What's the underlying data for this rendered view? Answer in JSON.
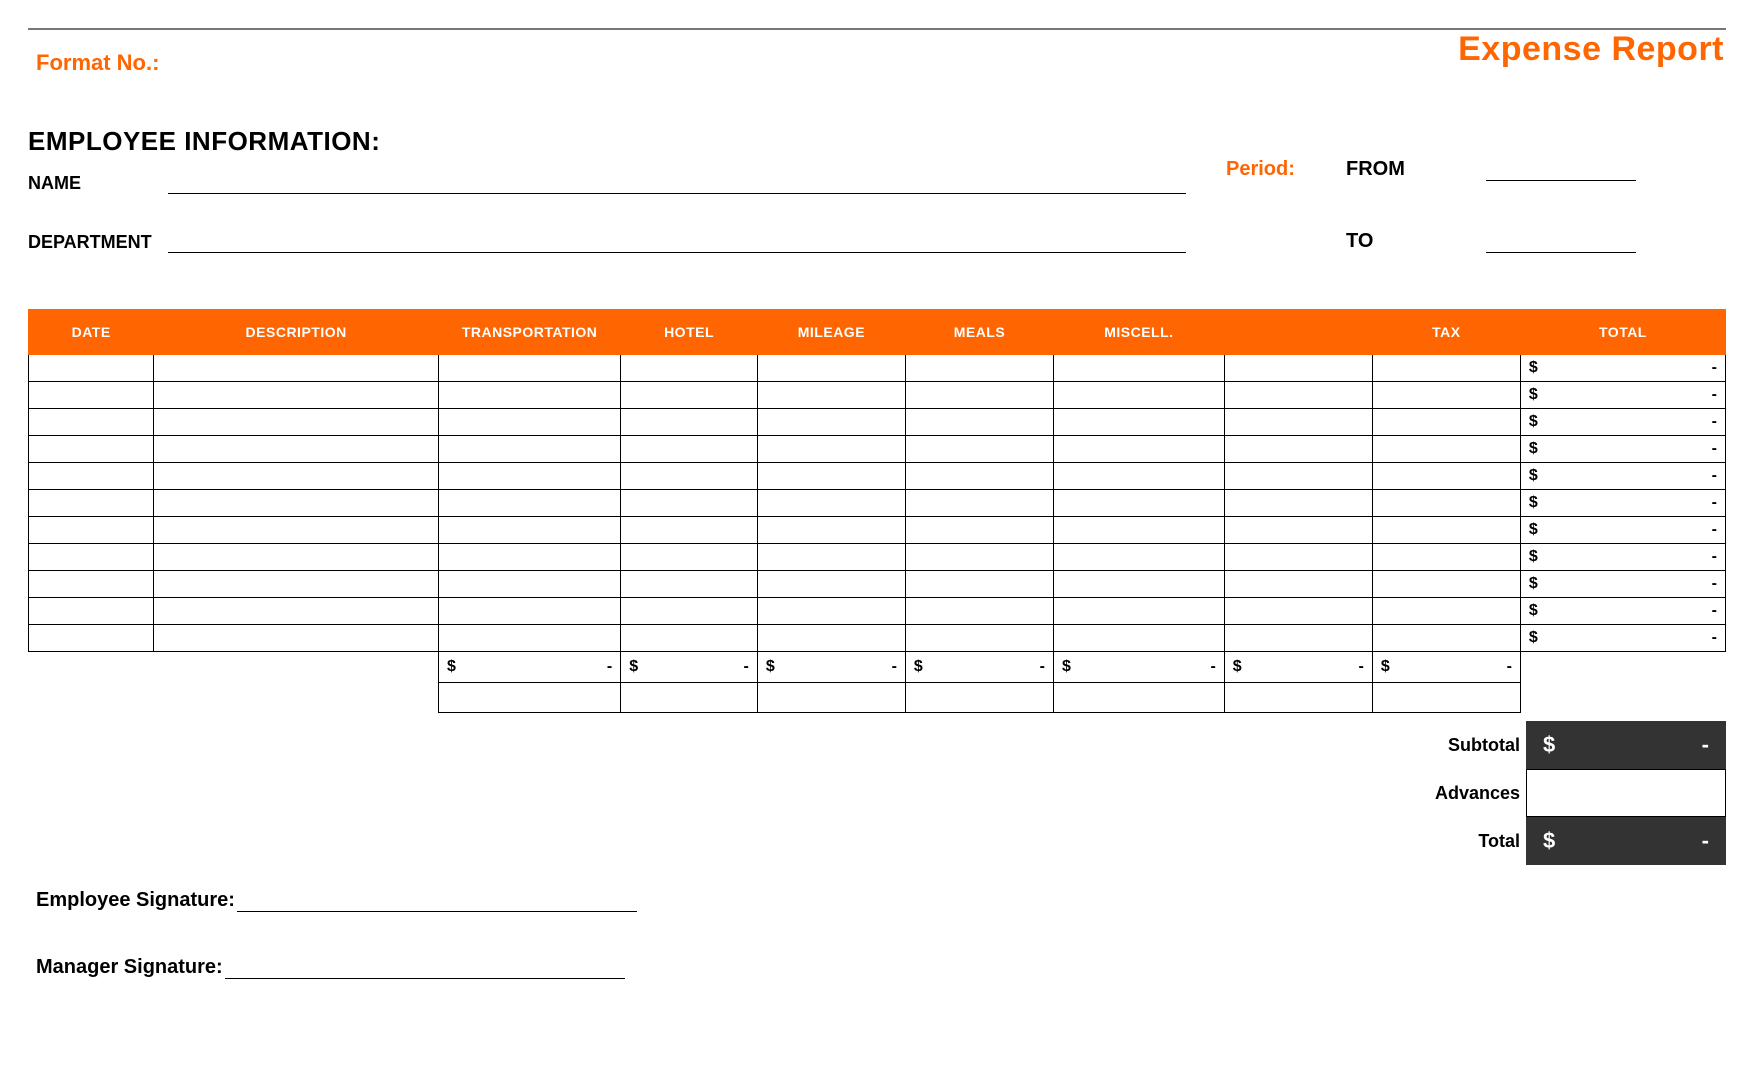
{
  "title": "Expense Report",
  "format_no_label": "Format No.:",
  "employee_info": {
    "heading": "EMPLOYEE INFORMATION:",
    "name_label": "NAME",
    "name_value": "",
    "department_label": "DEPARTMENT",
    "department_value": ""
  },
  "period": {
    "label": "Period:",
    "from_label": "FROM",
    "from_value": "",
    "to_label": "TO",
    "to_value": ""
  },
  "table": {
    "headers": [
      "DATE",
      "DESCRIPTION",
      "TRANSPORTATION",
      "HOTEL",
      "MILEAGE",
      "MEALS",
      "MISCELL.",
      "",
      "TAX",
      "TOTAL"
    ],
    "rows": [
      {
        "date": "",
        "description": "",
        "transportation": "",
        "hotel": "",
        "mileage": "",
        "meals": "",
        "miscell": "",
        "blank": "",
        "tax": "",
        "total_sym": "$",
        "total_val": "-"
      },
      {
        "date": "",
        "description": "",
        "transportation": "",
        "hotel": "",
        "mileage": "",
        "meals": "",
        "miscell": "",
        "blank": "",
        "tax": "",
        "total_sym": "$",
        "total_val": "-"
      },
      {
        "date": "",
        "description": "",
        "transportation": "",
        "hotel": "",
        "mileage": "",
        "meals": "",
        "miscell": "",
        "blank": "",
        "tax": "",
        "total_sym": "$",
        "total_val": "-"
      },
      {
        "date": "",
        "description": "",
        "transportation": "",
        "hotel": "",
        "mileage": "",
        "meals": "",
        "miscell": "",
        "blank": "",
        "tax": "",
        "total_sym": "$",
        "total_val": "-"
      },
      {
        "date": "",
        "description": "",
        "transportation": "",
        "hotel": "",
        "mileage": "",
        "meals": "",
        "miscell": "",
        "blank": "",
        "tax": "",
        "total_sym": "$",
        "total_val": "-"
      },
      {
        "date": "",
        "description": "",
        "transportation": "",
        "hotel": "",
        "mileage": "",
        "meals": "",
        "miscell": "",
        "blank": "",
        "tax": "",
        "total_sym": "$",
        "total_val": "-"
      },
      {
        "date": "",
        "description": "",
        "transportation": "",
        "hotel": "",
        "mileage": "",
        "meals": "",
        "miscell": "",
        "blank": "",
        "tax": "",
        "total_sym": "$",
        "total_val": "-"
      },
      {
        "date": "",
        "description": "",
        "transportation": "",
        "hotel": "",
        "mileage": "",
        "meals": "",
        "miscell": "",
        "blank": "",
        "tax": "",
        "total_sym": "$",
        "total_val": "-"
      },
      {
        "date": "",
        "description": "",
        "transportation": "",
        "hotel": "",
        "mileage": "",
        "meals": "",
        "miscell": "",
        "blank": "",
        "tax": "",
        "total_sym": "$",
        "total_val": "-"
      },
      {
        "date": "",
        "description": "",
        "transportation": "",
        "hotel": "",
        "mileage": "",
        "meals": "",
        "miscell": "",
        "blank": "",
        "tax": "",
        "total_sym": "$",
        "total_val": "-"
      },
      {
        "date": "",
        "description": "",
        "transportation": "",
        "hotel": "",
        "mileage": "",
        "meals": "",
        "miscell": "",
        "blank": "",
        "tax": "",
        "total_sym": "$",
        "total_val": "-"
      }
    ],
    "column_sums": {
      "transportation": {
        "sym": "$",
        "val": "-"
      },
      "hotel": {
        "sym": "$",
        "val": "-"
      },
      "mileage": {
        "sym": "$",
        "val": "-"
      },
      "meals": {
        "sym": "$",
        "val": "-"
      },
      "miscell": {
        "sym": "$",
        "val": "-"
      },
      "blank": {
        "sym": "$",
        "val": "-"
      },
      "tax": {
        "sym": "$",
        "val": "-"
      }
    }
  },
  "summary": {
    "subtotal_label": "Subtotal",
    "subtotal_sym": "$",
    "subtotal_val": "-",
    "advances_label": "Advances",
    "advances_val": "",
    "total_label": "Total",
    "total_sym": "$",
    "total_val": "-"
  },
  "signatures": {
    "employee_label": "Employee Signature:",
    "manager_label": "Manager Signature:"
  }
}
